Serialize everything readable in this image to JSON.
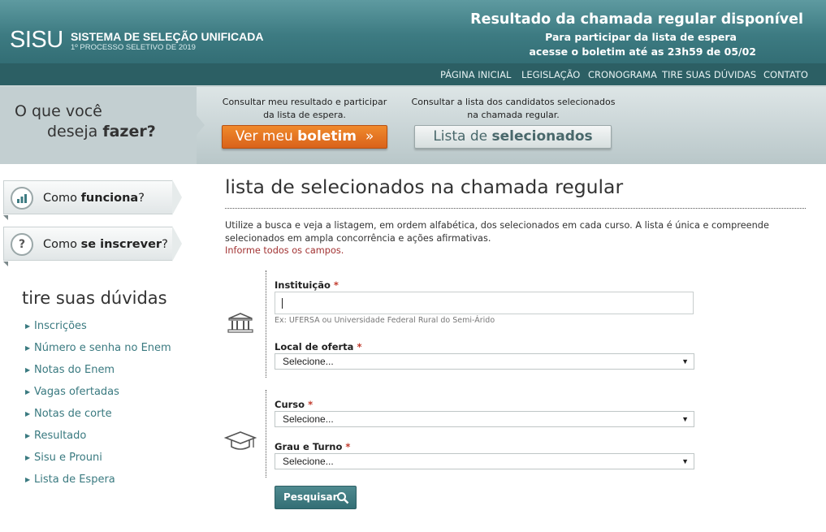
{
  "header": {
    "logo": "SISU",
    "logo_title": "SISTEMA DE SELEÇÃO UNIFICADA",
    "logo_subtitle": "1º PROCESSO SELETIVO DE 2019",
    "notice_title": "Resultado da chamada regular disponível",
    "notice_line1": "Para participar da lista de espera",
    "notice_line2": "acesse o boletim até as 23h59 de 05/02"
  },
  "nav": {
    "items": [
      "PÁGINA INICIAL",
      "LEGISLAÇÃO",
      "CRONOGRAMA",
      "TIRE SUAS DÚVIDAS",
      "CONTATO"
    ]
  },
  "actions": {
    "ask_line1": "O que você",
    "ask_line2_pre": "deseja ",
    "ask_line2_bold": "fazer?",
    "boletim_caption_1": "Consultar meu resultado e participar",
    "boletim_caption_2": "da lista de espera.",
    "boletim_pre": "Ver meu ",
    "boletim_bold": "boletim",
    "boletim_arrow": "»",
    "lista_caption_1": "Consultar a lista dos candidatos selecionados",
    "lista_caption_2": "na chamada regular.",
    "lista_pre": "Lista de ",
    "lista_bold": "selecionados"
  },
  "sidebar": {
    "buttons": [
      {
        "pre": "Como ",
        "bold": "funciona",
        "post": "?",
        "icon": "bar-chart-icon"
      },
      {
        "pre": "Como ",
        "bold": "se inscrever",
        "post": "?",
        "icon": "question-icon"
      }
    ],
    "faq_title": "tire suas dúvidas",
    "faq_items": [
      "Inscrições",
      "Número e senha no Enem",
      "Notas do Enem",
      "Vagas ofertadas",
      "Notas de corte",
      "Resultado",
      "Sisu e Prouni",
      "Lista de Espera"
    ]
  },
  "main": {
    "title": "lista de selecionados na chamada regular",
    "intro": "Utilize a busca e veja a listagem, em ordem alfabética, dos selecionados em cada curso. A lista é única e compreende selecionados em ampla concorrência e ações afirmativas.",
    "warning": "Informe todos os campos.",
    "instituicao_label": "Instituição",
    "instituicao_value": "",
    "instituicao_hint": "Ex: UFERSA ou Universidade Federal Rural do Semi-Árido",
    "local_label": "Local de oferta",
    "local_value": "Selecione...",
    "curso_label": "Curso",
    "curso_value": "Selecione...",
    "grau_label": "Grau e Turno",
    "grau_value": "Selecione...",
    "required_mark": "*",
    "search_button": "Pesquisar"
  },
  "colors": {
    "header_teal": "#3d7b82",
    "nav_dark_teal": "#2c5f64",
    "orange_button": "#e57322",
    "link_teal": "#3a7a80",
    "warning_red": "#a23232"
  }
}
